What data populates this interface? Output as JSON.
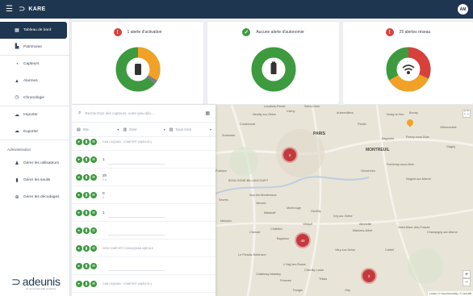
{
  "header": {
    "menu_icon": "menu-icon",
    "brand": "KARE",
    "avatar_initials": "AM"
  },
  "sidebar": {
    "items": [
      {
        "label": "Tableau de bord",
        "icon": "grid-icon",
        "active": true
      },
      {
        "label": "Patrimoine",
        "icon": "building-icon"
      },
      {
        "label": "Capteurs",
        "icon": "signal-icon"
      },
      {
        "label": "Alarmes",
        "icon": "bell-icon"
      },
      {
        "label": "Chronologie",
        "icon": "clock-icon"
      },
      {
        "label": "Importer",
        "icon": "cloud-upload-icon"
      },
      {
        "label": "Exporter",
        "icon": "cloud-download-icon"
      }
    ],
    "section_title": "Administration",
    "admin_items": [
      {
        "label": "Gérer les utilisateurs",
        "icon": "users-icon"
      },
      {
        "label": "Gérer les seuils",
        "icon": "threshold-icon"
      },
      {
        "label": "Gérer les décodages",
        "icon": "decode-icon"
      }
    ],
    "footer_brand": "adeunis",
    "footer_tagline": "be connected with simplicity"
  },
  "cards": [
    {
      "title": "1 alerte d'activation",
      "status": "alert",
      "status_color": "#d9403b",
      "center_icon": "device-icon"
    },
    {
      "title": "Aucune alerte d'autonomie",
      "status": "ok",
      "status_color": "#3d9a3f",
      "center_icon": "battery-icon"
    },
    {
      "title": "25 alertes réseau",
      "status": "alert",
      "status_color": "#d9403b",
      "center_icon": "wifi-icon"
    }
  ],
  "panel": {
    "search_placeholder": "Recherchez des capteurs, votre ipau allo...",
    "filters": [
      {
        "label": "Site",
        "icon": "site-icon"
      },
      {
        "label": "Zone",
        "icon": "zone-icon"
      },
      {
        "label": "Sous zone",
        "icon": "subzone-icon"
      }
    ],
    "rows": [
      {
        "name": "",
        "sub": "CAN CAQHAN - COMFORT (0@EA 9C)"
      },
      {
        "name": "1",
        "sub": ""
      },
      {
        "name": "2h",
        "sub": "2.0"
      },
      {
        "name": "0",
        "sub": "0"
      },
      {
        "name": "1",
        "sub": ""
      },
      {
        "name": "",
        "sub": ""
      },
      {
        "name": "",
        "sub": "DEM COMFORT CONVAQHAN 0@EA16"
      },
      {
        "name": "",
        "sub": ""
      },
      {
        "name": "",
        "sub": "CAN CAQHAN - COMFORT (0@EA 9C)"
      }
    ]
  },
  "map": {
    "labels": [
      {
        "text": "PARIS",
        "big": true
      },
      {
        "text": "MONTREUIL",
        "big": true
      },
      {
        "text": "Neuilly-sur-Seine"
      },
      {
        "text": "Levallois-Perret"
      },
      {
        "text": "Clichy"
      },
      {
        "text": "Saint-Ouen"
      },
      {
        "text": "Aubervilliers"
      },
      {
        "text": "Pantin"
      },
      {
        "text": "Bagnolet"
      },
      {
        "text": "Vincennes"
      },
      {
        "text": "BOULOGNE-BILLANCOURT"
      },
      {
        "text": "Issy-les-Moulineaux"
      },
      {
        "text": "Montrouge"
      },
      {
        "text": "Malakoff"
      },
      {
        "text": "Vanves"
      },
      {
        "text": "Gentilly"
      },
      {
        "text": "Ivry-sur-Seine"
      },
      {
        "text": "Vitry-sur-Seine"
      },
      {
        "text": "Villejuif"
      },
      {
        "text": "Créteil"
      },
      {
        "text": "Chevilly-Larue"
      },
      {
        "text": "Thiais"
      },
      {
        "text": "Rungis"
      },
      {
        "text": "Orly"
      },
      {
        "text": "Fontenay-sous-Bois"
      },
      {
        "text": "Nogent-sur-Marne"
      },
      {
        "text": "Champigny-sur-Marne"
      },
      {
        "text": "Bondy"
      },
      {
        "text": "Villemomble"
      },
      {
        "text": "Rosny-sous-Bois"
      },
      {
        "text": "Noisy-le-Sec"
      },
      {
        "text": "Le Plessis-Robinson"
      },
      {
        "text": "Clamart"
      },
      {
        "text": "Meudon"
      },
      {
        "text": "Sèvres"
      },
      {
        "text": "Suresnes"
      },
      {
        "text": "Puteaux"
      },
      {
        "text": "Courbevoie"
      },
      {
        "text": "Maisons-Alfort"
      },
      {
        "text": "Alfortville"
      },
      {
        "text": "Saint-Maur-des-Fossés"
      },
      {
        "text": "Châtillon"
      },
      {
        "text": "Bagneux"
      },
      {
        "text": "Châtenay-Malabry"
      },
      {
        "text": "Fresnes"
      },
      {
        "text": "L'Haÿ-les-Roses"
      },
      {
        "text": "Gagny"
      }
    ],
    "clusters": [
      {
        "count": "2"
      },
      {
        "count": "40"
      },
      {
        "count": "3"
      }
    ],
    "zoom_in": "+",
    "zoom_out": "−",
    "fullscreen_icon": "fullscreen-icon",
    "attribution": "Leaflet | © OpenStreetMap, © CartoDB"
  },
  "colors": {
    "navy": "#1f3651",
    "green": "#3d9a3f",
    "orange": "#f1a126",
    "red": "#d9403b",
    "cluster": "#c4393c"
  }
}
